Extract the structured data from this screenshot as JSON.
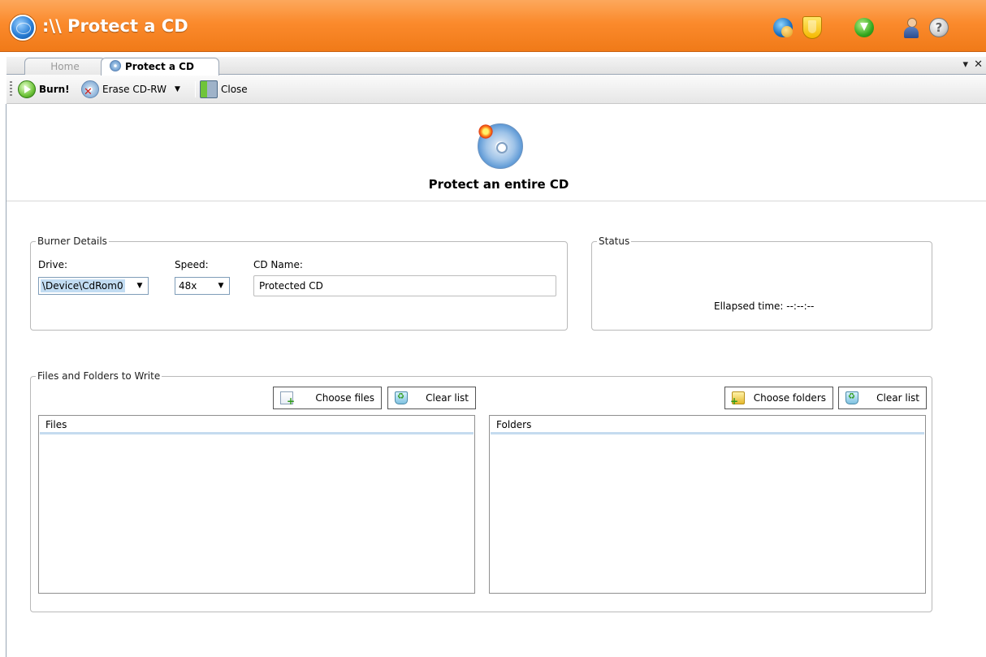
{
  "window": {
    "title": ":\\\\ Protect a CD"
  },
  "tabs": [
    {
      "label": "Home",
      "active": false
    },
    {
      "label": "Protect a CD",
      "active": true
    }
  ],
  "tab_controls": {
    "dropdown": "▾",
    "close": "✕"
  },
  "toolbar": {
    "burn_label": "Burn!",
    "erase_label": "Erase CD-RW",
    "erase_arrow": "▼",
    "close_label": "Close"
  },
  "header": {
    "icon": "cd-protect-icon",
    "title": "Protect an entire CD"
  },
  "burner_details": {
    "legend": "Burner Details",
    "drive_label": "Drive:",
    "drive_value": "\\Device\\CdRom0",
    "speed_label": "Speed:",
    "speed_value": "48x",
    "cdname_label": "CD Name:",
    "cdname_value": "Protected CD",
    "arrow": "▼"
  },
  "status": {
    "legend": "Status",
    "elapsed_label": "Ellapsed time: --:--:--"
  },
  "files_folders": {
    "legend": "Files and Folders to Write",
    "choose_files": "Choose files",
    "clear_files": "Clear list",
    "choose_folders": "Choose folders",
    "clear_folders": "Clear list",
    "files_header": "Files",
    "folders_header": "Folders"
  },
  "colors": {
    "titlebar": "#f7902d",
    "list_header_underline": "#c5dbef",
    "selection": "#c2dcf2"
  }
}
